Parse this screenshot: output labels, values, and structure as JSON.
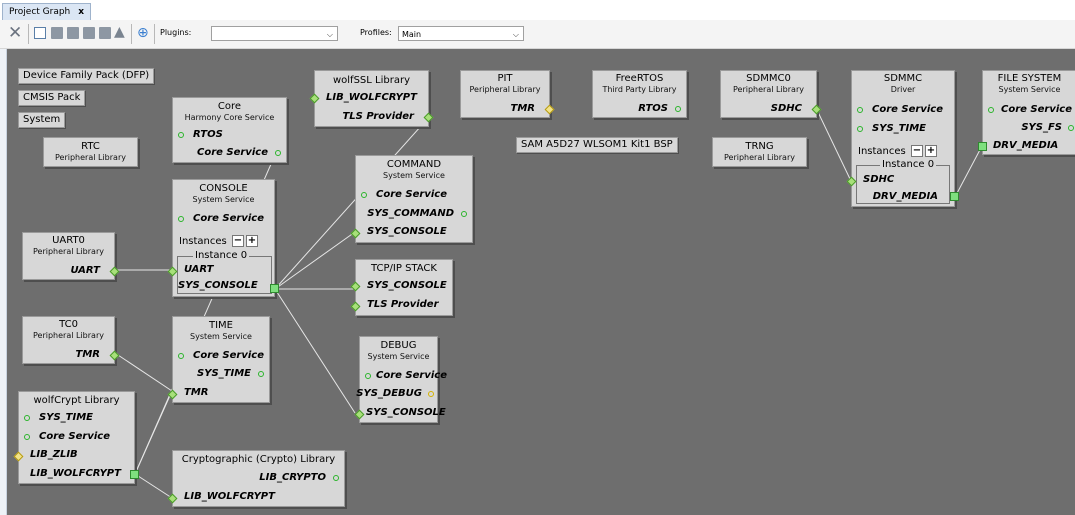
{
  "tab": {
    "label": "Project Graph",
    "close": "x"
  },
  "toolbar": {
    "plugins_label": "Plugins:",
    "plugins_value": "",
    "profiles_label": "Profiles:",
    "profiles_value": "Main"
  },
  "colors": {
    "canvas": "#6e6e6e",
    "node": "#d7d7d7",
    "port_green": "#7fe07f",
    "port_yellow": "#f2e38a"
  },
  "buttons": {
    "dfp": "Device Family Pack (DFP)",
    "cmsis": "CMSIS Pack",
    "system": "System",
    "bsp": "SAM A5D27 WLSOM1 Kit1 BSP"
  },
  "nodes": {
    "rtc": {
      "title": "RTC",
      "sub": "Peripheral Library"
    },
    "core": {
      "title": "Core",
      "sub": "Harmony Core Service",
      "rtos": "RTOS",
      "core_service": "Core Service"
    },
    "wolfssl": {
      "title": "wolfSSL Library",
      "lib_wolfcrypt": "LIB_WOLFCRYPT",
      "tls_provider": "TLS Provider"
    },
    "pit": {
      "title": "PIT",
      "sub": "Peripheral Library",
      "tmr": "TMR"
    },
    "freertos": {
      "title": "FreeRTOS",
      "sub": "Third Party Library",
      "rtos": "RTOS"
    },
    "sdmmc0": {
      "title": "SDMMC0",
      "sub": "Peripheral Library",
      "sdhc": "SDHC"
    },
    "trng": {
      "title": "TRNG",
      "sub": "Peripheral Library"
    },
    "sdmmc": {
      "title": "SDMMC",
      "sub": "Driver",
      "core_service": "Core Service",
      "sys_time": "SYS_TIME",
      "instances": "Instances",
      "instance0": "Instance 0",
      "sdhc": "SDHC",
      "drv_media": "DRV_MEDIA"
    },
    "filesystem": {
      "title": "FILE SYSTEM",
      "sub": "System Service",
      "core_service": "Core Service",
      "sys_fs": "SYS_FS",
      "drv_media": "DRV_MEDIA"
    },
    "console": {
      "title": "CONSOLE",
      "sub": "System Service",
      "core_service": "Core Service",
      "instances": "Instances",
      "instance0": "Instance 0",
      "uart": "UART",
      "sys_console": "SYS_CONSOLE"
    },
    "command": {
      "title": "COMMAND",
      "sub": "System Service",
      "core_service": "Core Service",
      "sys_command": "SYS_COMMAND",
      "sys_console": "SYS_CONSOLE"
    },
    "uart0": {
      "title": "UART0",
      "sub": "Peripheral Library",
      "uart": "UART"
    },
    "tcpip": {
      "title": "TCP/IP STACK",
      "sys_console": "SYS_CONSOLE",
      "tls_provider": "TLS Provider"
    },
    "tc0": {
      "title": "TC0",
      "sub": "Peripheral Library",
      "tmr": "TMR"
    },
    "time": {
      "title": "TIME",
      "sub": "System Service",
      "core_service": "Core Service",
      "sys_time": "SYS_TIME",
      "tmr": "TMR"
    },
    "debug": {
      "title": "DEBUG",
      "sub": "System Service",
      "core_service": "Core Service",
      "sys_debug": "SYS_DEBUG",
      "sys_console": "SYS_CONSOLE"
    },
    "wolfcrypt": {
      "title": "wolfCrypt Library",
      "sys_time": "SYS_TIME",
      "core_service": "Core Service",
      "lib_zlib": "LIB_ZLIB",
      "lib_wolfcrypt": "LIB_WOLFCRYPT"
    },
    "crypto": {
      "title": "Cryptographic (Crypto) Library",
      "lib_crypto": "LIB_CRYPTO",
      "lib_wolfcrypt": "LIB_WOLFCRYPT"
    }
  }
}
